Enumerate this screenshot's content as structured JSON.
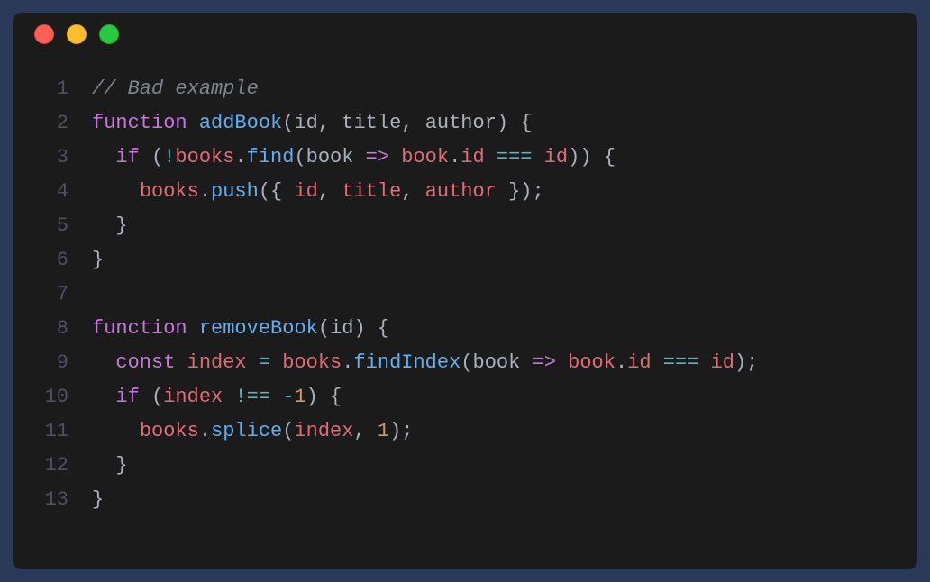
{
  "window": {
    "dots": [
      "red",
      "yellow",
      "green"
    ]
  },
  "gutter": [
    "1",
    "2",
    "3",
    "4",
    "5",
    "6",
    "7",
    "8",
    "9",
    "10",
    "11",
    "12",
    "13"
  ],
  "code": {
    "lines": [
      [
        {
          "c": "tok-comment",
          "t": "// Bad example"
        }
      ],
      [
        {
          "c": "tok-keyword",
          "t": "function"
        },
        {
          "c": "tok-plain",
          "t": " "
        },
        {
          "c": "tok-funcdef",
          "t": "addBook"
        },
        {
          "c": "tok-punct",
          "t": "("
        },
        {
          "c": "tok-param",
          "t": "id"
        },
        {
          "c": "tok-punct",
          "t": ", "
        },
        {
          "c": "tok-param",
          "t": "title"
        },
        {
          "c": "tok-punct",
          "t": ", "
        },
        {
          "c": "tok-param",
          "t": "author"
        },
        {
          "c": "tok-punct",
          "t": ") {"
        }
      ],
      [
        {
          "c": "tok-plain",
          "t": "  "
        },
        {
          "c": "tok-keyword",
          "t": "if"
        },
        {
          "c": "tok-plain",
          "t": " "
        },
        {
          "c": "tok-punct",
          "t": "("
        },
        {
          "c": "tok-op",
          "t": "!"
        },
        {
          "c": "tok-ident",
          "t": "books"
        },
        {
          "c": "tok-punct",
          "t": "."
        },
        {
          "c": "tok-method",
          "t": "find"
        },
        {
          "c": "tok-punct",
          "t": "("
        },
        {
          "c": "tok-param",
          "t": "book"
        },
        {
          "c": "tok-plain",
          "t": " "
        },
        {
          "c": "tok-keyword",
          "t": "=>"
        },
        {
          "c": "tok-plain",
          "t": " "
        },
        {
          "c": "tok-ident",
          "t": "book"
        },
        {
          "c": "tok-punct",
          "t": "."
        },
        {
          "c": "tok-propred",
          "t": "id"
        },
        {
          "c": "tok-plain",
          "t": " "
        },
        {
          "c": "tok-op",
          "t": "==="
        },
        {
          "c": "tok-plain",
          "t": " "
        },
        {
          "c": "tok-ident",
          "t": "id"
        },
        {
          "c": "tok-punct",
          "t": ")) {"
        }
      ],
      [
        {
          "c": "tok-plain",
          "t": "    "
        },
        {
          "c": "tok-ident",
          "t": "books"
        },
        {
          "c": "tok-punct",
          "t": "."
        },
        {
          "c": "tok-method",
          "t": "push"
        },
        {
          "c": "tok-punct",
          "t": "({ "
        },
        {
          "c": "tok-ident",
          "t": "id"
        },
        {
          "c": "tok-punct",
          "t": ", "
        },
        {
          "c": "tok-ident",
          "t": "title"
        },
        {
          "c": "tok-punct",
          "t": ", "
        },
        {
          "c": "tok-ident",
          "t": "author"
        },
        {
          "c": "tok-punct",
          "t": " });"
        }
      ],
      [
        {
          "c": "tok-plain",
          "t": "  "
        },
        {
          "c": "tok-punct",
          "t": "}"
        }
      ],
      [
        {
          "c": "tok-punct",
          "t": "}"
        }
      ],
      [
        {
          "c": "tok-plain",
          "t": ""
        }
      ],
      [
        {
          "c": "tok-keyword",
          "t": "function"
        },
        {
          "c": "tok-plain",
          "t": " "
        },
        {
          "c": "tok-funcdef",
          "t": "removeBook"
        },
        {
          "c": "tok-punct",
          "t": "("
        },
        {
          "c": "tok-param",
          "t": "id"
        },
        {
          "c": "tok-punct",
          "t": ") {"
        }
      ],
      [
        {
          "c": "tok-plain",
          "t": "  "
        },
        {
          "c": "tok-keyword",
          "t": "const"
        },
        {
          "c": "tok-plain",
          "t": " "
        },
        {
          "c": "tok-ident",
          "t": "index"
        },
        {
          "c": "tok-plain",
          "t": " "
        },
        {
          "c": "tok-op",
          "t": "="
        },
        {
          "c": "tok-plain",
          "t": " "
        },
        {
          "c": "tok-ident",
          "t": "books"
        },
        {
          "c": "tok-punct",
          "t": "."
        },
        {
          "c": "tok-method",
          "t": "findIndex"
        },
        {
          "c": "tok-punct",
          "t": "("
        },
        {
          "c": "tok-param",
          "t": "book"
        },
        {
          "c": "tok-plain",
          "t": " "
        },
        {
          "c": "tok-keyword",
          "t": "=>"
        },
        {
          "c": "tok-plain",
          "t": " "
        },
        {
          "c": "tok-ident",
          "t": "book"
        },
        {
          "c": "tok-punct",
          "t": "."
        },
        {
          "c": "tok-propred",
          "t": "id"
        },
        {
          "c": "tok-plain",
          "t": " "
        },
        {
          "c": "tok-op",
          "t": "==="
        },
        {
          "c": "tok-plain",
          "t": " "
        },
        {
          "c": "tok-ident",
          "t": "id"
        },
        {
          "c": "tok-punct",
          "t": ");"
        }
      ],
      [
        {
          "c": "tok-plain",
          "t": "  "
        },
        {
          "c": "tok-keyword",
          "t": "if"
        },
        {
          "c": "tok-plain",
          "t": " "
        },
        {
          "c": "tok-punct",
          "t": "("
        },
        {
          "c": "tok-ident",
          "t": "index"
        },
        {
          "c": "tok-plain",
          "t": " "
        },
        {
          "c": "tok-op",
          "t": "!=="
        },
        {
          "c": "tok-plain",
          "t": " "
        },
        {
          "c": "tok-op",
          "t": "-"
        },
        {
          "c": "tok-number",
          "t": "1"
        },
        {
          "c": "tok-punct",
          "t": ") {"
        }
      ],
      [
        {
          "c": "tok-plain",
          "t": "    "
        },
        {
          "c": "tok-ident",
          "t": "books"
        },
        {
          "c": "tok-punct",
          "t": "."
        },
        {
          "c": "tok-method",
          "t": "splice"
        },
        {
          "c": "tok-punct",
          "t": "("
        },
        {
          "c": "tok-ident",
          "t": "index"
        },
        {
          "c": "tok-punct",
          "t": ", "
        },
        {
          "c": "tok-number",
          "t": "1"
        },
        {
          "c": "tok-punct",
          "t": ");"
        }
      ],
      [
        {
          "c": "tok-plain",
          "t": "  "
        },
        {
          "c": "tok-punct",
          "t": "}"
        }
      ],
      [
        {
          "c": "tok-punct",
          "t": "}"
        }
      ]
    ]
  }
}
